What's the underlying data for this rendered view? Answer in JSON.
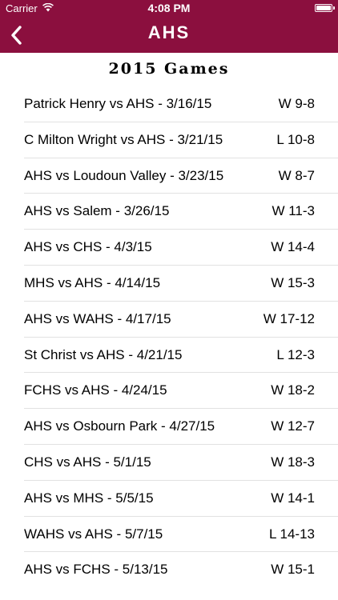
{
  "status_bar": {
    "carrier": "Carrier",
    "time": "4:08 PM"
  },
  "nav": {
    "title": "AHS",
    "back_icon": "chevron-left-icon"
  },
  "section_title": "2015 Games",
  "games": [
    {
      "matchup": "Patrick Henry vs AHS - 3/16/15",
      "result": "W 9-8"
    },
    {
      "matchup": "C Milton Wright vs AHS - 3/21/15",
      "result": "L 10-8"
    },
    {
      "matchup": "AHS vs Loudoun Valley - 3/23/15",
      "result": "W 8-7"
    },
    {
      "matchup": "AHS vs Salem - 3/26/15",
      "result": "W 11-3"
    },
    {
      "matchup": "AHS vs CHS - 4/3/15",
      "result": "W 14-4"
    },
    {
      "matchup": "MHS vs AHS - 4/14/15",
      "result": "W 15-3"
    },
    {
      "matchup": "AHS vs WAHS - 4/17/15",
      "result": "W 17-12"
    },
    {
      "matchup": "St Christ vs AHS - 4/21/15",
      "result": "L 12-3"
    },
    {
      "matchup": "FCHS vs AHS - 4/24/15",
      "result": "W 18-2"
    },
    {
      "matchup": "AHS vs Osbourn Park - 4/27/15",
      "result": "W 12-7"
    },
    {
      "matchup": "CHS vs AHS - 5/1/15",
      "result": "W 18-3"
    },
    {
      "matchup": "AHS vs MHS - 5/5/15",
      "result": "W 14-1"
    },
    {
      "matchup": "WAHS vs AHS - 5/7/15",
      "result": "L 14-13"
    },
    {
      "matchup": "AHS vs FCHS - 5/13/15",
      "result": "W 15-1"
    }
  ],
  "colors": {
    "header_background": "#8b0f3e",
    "header_text": "#ffffff",
    "separator": "#e2e2e2"
  }
}
